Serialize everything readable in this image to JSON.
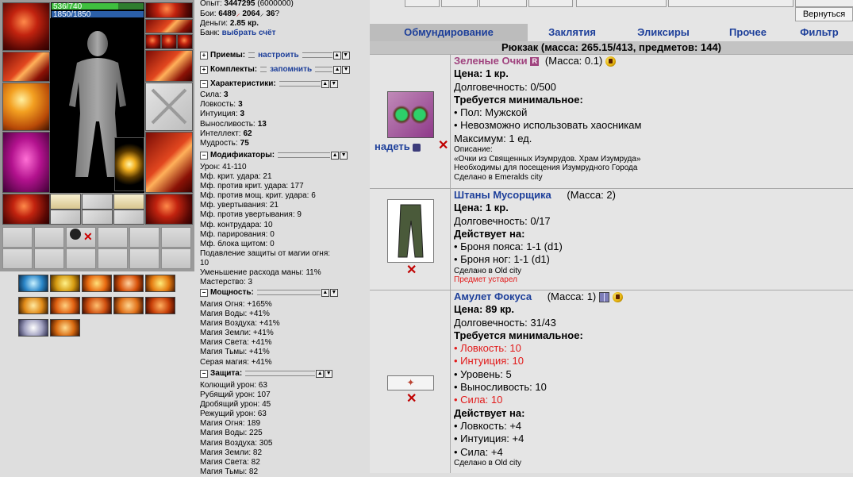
{
  "player": {
    "hp_text": "536/740",
    "hp_fraction": 0.72,
    "mp_text": "1850/1850",
    "exp_label": "Опыт:",
    "exp_value": "3447295",
    "exp_next": "(6000000)",
    "fights_label": "Бои:",
    "wins": "6489",
    "losses": "2064",
    "draws": "36",
    "money_label": "Деньги:",
    "money_value": "2.85 кр.",
    "bank_label": "Банк:",
    "bank_link": "выбрать счёт"
  },
  "equipment_slots": [
    {
      "name": "helmet-slot",
      "icon": "red-armor-icon"
    },
    {
      "name": "bracers-slot",
      "icon": "red-bracers-icon"
    },
    {
      "name": "weapon-slot",
      "icon": "fire-mace-icon"
    },
    {
      "name": "armor-slot",
      "icon": "magenta-robe-icon"
    },
    {
      "name": "belt-slot",
      "icon": "belt-icon"
    },
    {
      "name": "earrings-slot",
      "icon": "earrings-icon"
    },
    {
      "name": "amulet-slot",
      "icon": "amulet-icon"
    },
    {
      "name": "rings-slot",
      "icon": "rings-icon"
    },
    {
      "name": "gloves-slot",
      "icon": "red-gloves-icon"
    },
    {
      "name": "shield-slot",
      "icon": "crossed-swords-icon"
    },
    {
      "name": "leggings-slot",
      "icon": "red-leggings-icon"
    },
    {
      "name": "boots-slot",
      "icon": "red-boots-icon"
    }
  ],
  "sections": {
    "tricks": {
      "title": "Приемы:",
      "link": "настроить",
      "toggle": "+"
    },
    "sets": {
      "title": "Комплекты:",
      "link": "запомнить",
      "toggle": "+"
    },
    "characteristics": {
      "title": "Характеристики:",
      "toggle": "−"
    },
    "modifiers": {
      "title": "Модификаторы:",
      "toggle": "−"
    },
    "powers": {
      "title": "Мощность:",
      "toggle": "−"
    },
    "protection": {
      "title": "Защита:",
      "toggle": "−"
    }
  },
  "characteristics": [
    {
      "label": "Сила:",
      "value": "3"
    },
    {
      "label": "Ловкость:",
      "value": "3"
    },
    {
      "label": "Интуиция:",
      "value": "3"
    },
    {
      "label": "Выносливость:",
      "value": "13"
    },
    {
      "label": "Интеллект:",
      "value": "62"
    },
    {
      "label": "Мудрость:",
      "value": "75"
    }
  ],
  "modifiers": [
    "Урон: 41-110",
    "Мф. крит. удара: 21",
    "Мф. против крит. удара: 177",
    "Мф. против мощ. крит. удара: 6",
    "Мф. увертывания: 21",
    "Мф. против увертывания: 9",
    "Мф. контрудара: 10",
    "Мф. парирования: 0",
    "Мф. блока щитом: 0",
    "Подавление защиты от магии огня:",
    "10",
    "Уменьшение расхода маны: 11%",
    "Мастерство: 3"
  ],
  "powers": [
    "Магия Огня: +165%",
    "Магия Воды: +41%",
    "Магия Воздуха: +41%",
    "Магия Земли: +41%",
    "Магия Света: +41%",
    "Магия Тьмы: +41%",
    "Серая магия: +41%"
  ],
  "protection": [
    "Колющий урон: 63",
    "Рубящий урон: 107",
    "Дробящий урон: 45",
    "Режущий урон: 63",
    "Магия Огня: 189",
    "Магия Воды: 225",
    "Магия Воздуха: 305",
    "Магия Земли: 82",
    "Магия Света: 82",
    "Магия Тьмы: 82"
  ],
  "nav": {
    "back_label": "Вернуться",
    "tabs": [
      "Обмундирование",
      "Заклятия",
      "Эликсиры",
      "Прочее",
      "Фильтр"
    ],
    "active_tab": "Обмундирование"
  },
  "backpack": {
    "header": "Рюкзак (масса: 265.15/413, предметов: 144)"
  },
  "items": [
    {
      "name": "Зеленые Очки",
      "badge": "R",
      "mass": "(Масса: 0.1)",
      "price": "Цена: 1 кр.",
      "durability": "Долговечность: 0/500",
      "req_header": "Требуется минимальное:",
      "req": [
        "• Пол: Мужской",
        "• Невозможно использовать хаосникам"
      ],
      "max": "Максимум: 1 ед.",
      "desc_label": "Описание:",
      "desc_text": "«Очки из Священных Изумрудов. Храм Изумруда»",
      "desc_note": "Необходимы для посещения Изумрудного Города",
      "made_in": "Сделано в Emeralds city",
      "wear_label": "надеть"
    },
    {
      "name": "Штаны Мусорщика",
      "mass": "(Масса: 2)",
      "price": "Цена: 1 кр.",
      "durability": "Долговечность: 0/17",
      "acts_header": "Действует на:",
      "acts": [
        "• Броня пояса: 1-1 (d1)",
        "• Броня ног: 1-1 (d1)"
      ],
      "made_in": "Сделано в Old city",
      "obsolete": "Предмет устарел"
    },
    {
      "name": "Амулет Фокуса",
      "mass": "(Масса: 1)",
      "price": "Цена: 89 кр.",
      "durability": "Долговечность: 31/43",
      "req_header": "Требуется минимальное:",
      "req": [
        {
          "text": "• Ловкость: 10",
          "unmet": true
        },
        {
          "text": "• Интуиция: 10",
          "unmet": true
        },
        {
          "text": "• Уровень: 5",
          "unmet": false
        },
        {
          "text": "• Выносливость: 10",
          "unmet": false
        },
        {
          "text": "• Сила: 10",
          "unmet": true
        }
      ],
      "acts_header": "Действует на:",
      "acts": [
        "• Ловкость: +4",
        "• Интуиция: +4",
        "• Сила: +4"
      ],
      "made_in": "Сделано в Old city"
    }
  ],
  "colors": {
    "link": "#1d3f9a",
    "unmet_requirement": "#e21a1a",
    "item_name_rare": "#a0447f",
    "item_name_normal": "#1d3f9a"
  }
}
